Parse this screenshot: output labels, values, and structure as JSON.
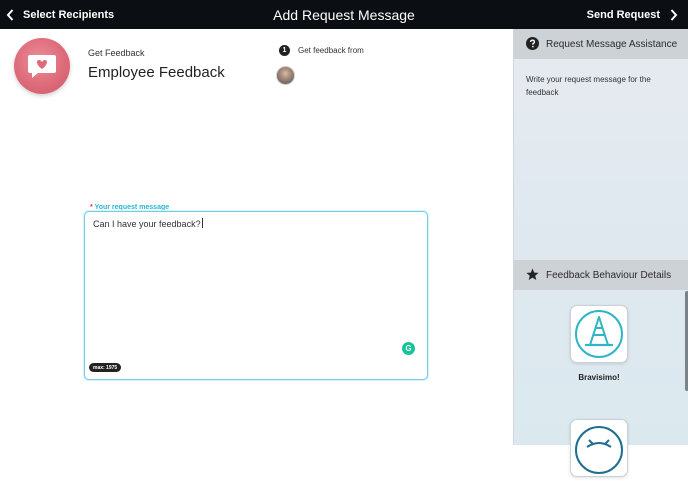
{
  "header": {
    "back_label": "Select Recipients",
    "title": "Add Request Message",
    "next_label": "Send Request"
  },
  "feedback": {
    "type_label": "Get Feedback",
    "title": "Employee Feedback",
    "icon": "heart-speech-bubble-icon"
  },
  "recipients": {
    "step_number": "1",
    "step_label": "Get feedback from"
  },
  "request": {
    "required_marker": "*",
    "label": "Your request message",
    "value": "Can I have your feedback?",
    "max_label": "max: 1975",
    "grammarly_glyph": "G"
  },
  "sidebar": {
    "assistance_title": "Request Message Assistance",
    "assistance_text": "Write your request message for the feedback",
    "behaviour_title": "Feedback Behaviour Details",
    "cards": [
      {
        "label": "Bravisimo!",
        "icon": "traffic-cone-icon"
      },
      {
        "label": "",
        "icon": "robot-face-icon"
      }
    ]
  },
  "colors": {
    "topbar": "#0b0f14",
    "accent": "#29b6d2",
    "feedback_icon": "#de6b7a",
    "sidebar_bg": "#e2e9ef",
    "grammarly": "#15c39a"
  }
}
